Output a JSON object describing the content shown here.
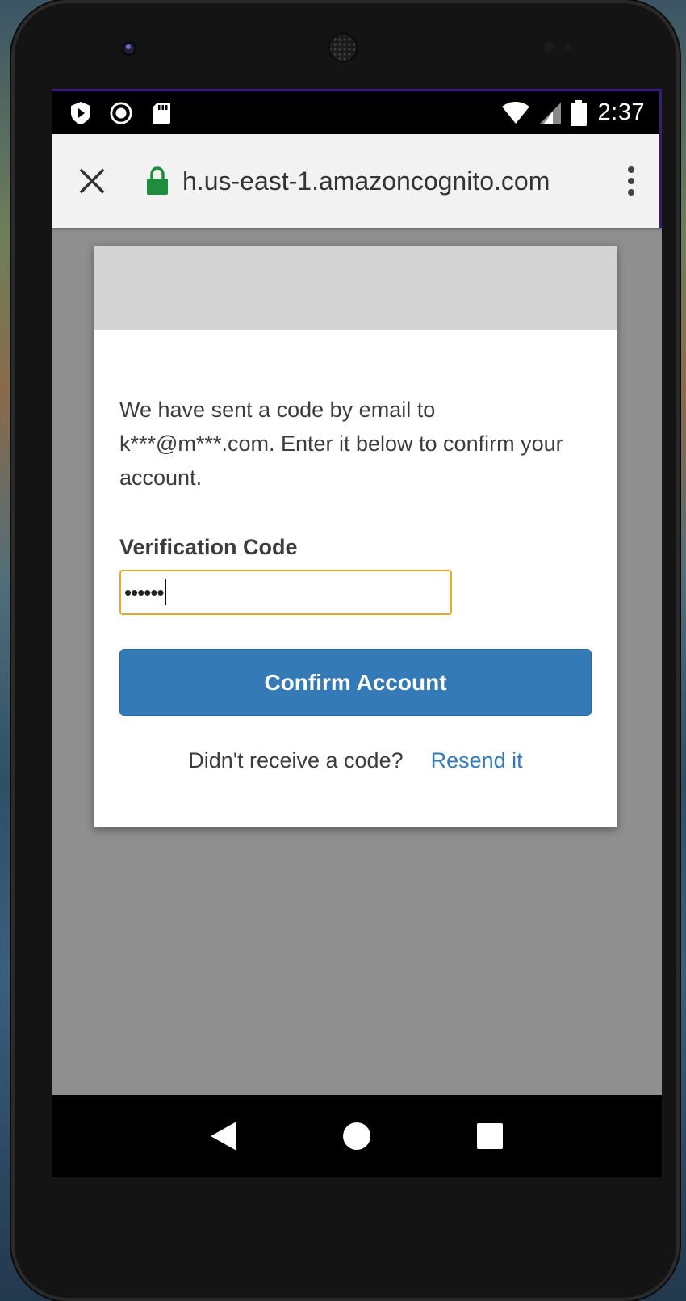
{
  "status_bar": {
    "time": "2:37",
    "left_icons": [
      "play-protect-icon",
      "record-icon",
      "sd-card-icon"
    ],
    "right_icons": [
      "wifi-icon",
      "cell-signal-icon",
      "battery-icon"
    ]
  },
  "browser": {
    "url": "h.us-east-1.amazoncognito.com",
    "close_icon": "close-icon",
    "lock_icon": "lock-icon",
    "menu_icon": "more-vert-icon"
  },
  "form": {
    "message": "We have sent a code by email to k***@m***.com. Enter it below to confirm your account.",
    "code_label": "Verification Code",
    "code_value": "••••••",
    "confirm_label": "Confirm Account",
    "resend_prompt": "Didn't receive a code?",
    "resend_link": "Resend it"
  },
  "nav_bar": {
    "icons": [
      "back-icon",
      "home-icon",
      "recents-icon"
    ]
  },
  "colors": {
    "primary": "#337ab7",
    "input_focus": "#e8a92b",
    "lock": "#1e8e3e",
    "backdrop": "#8f8f8f"
  }
}
